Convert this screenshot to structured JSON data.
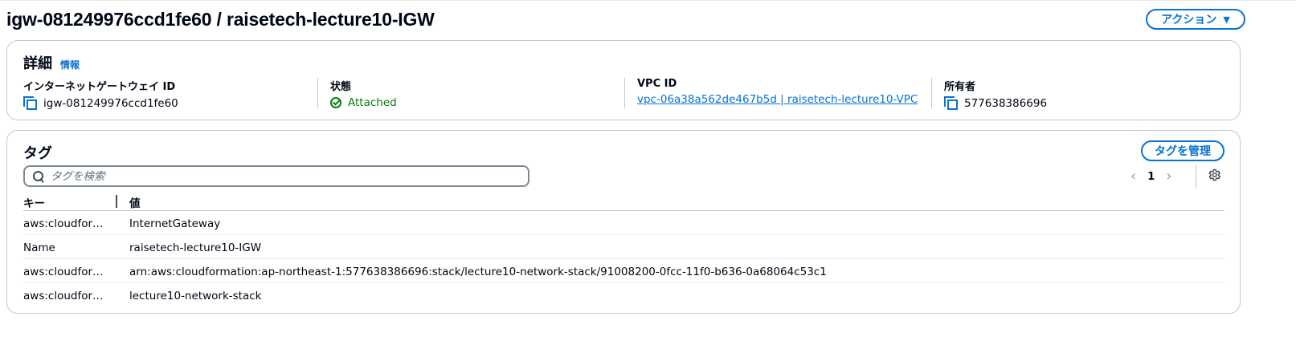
{
  "page": {
    "title": "igw-081249976ccd1fe60 / raisetech-lecture10-IGW",
    "actions_label": "アクション",
    "actions_caret": "▼"
  },
  "details": {
    "title": "詳細",
    "info_link": "情報",
    "fields": [
      {
        "label": "インターネットゲートウェイ ID",
        "value": "igw-081249976ccd1fe60",
        "icon": "copy-icon"
      },
      {
        "label": "状態",
        "value": "Attached",
        "icon": "status-success-icon",
        "color": "#037f0c"
      },
      {
        "label": "VPC ID",
        "value": "vpc-06a38a562de467b5d | raisetech-lecture10-VPC",
        "link": true
      },
      {
        "label": "所有者",
        "value": "577638386696",
        "icon": "copy-icon"
      }
    ]
  },
  "tags": {
    "title": "タグ",
    "manage_label": "タグを管理",
    "search_placeholder": "タグを検索",
    "pagination": {
      "prev": "‹",
      "page": "1",
      "next": "›"
    },
    "columns": [
      "キー",
      "値"
    ],
    "rows": [
      {
        "key": "aws:cloudfor…",
        "value": "InternetGateway"
      },
      {
        "key": "Name",
        "value": "raisetech-lecture10-IGW"
      },
      {
        "key": "aws:cloudfor…",
        "value": "arn:aws:cloudformation:ap-northeast-1:577638386696:stack/lecture10-network-stack/91008200-0fcc-11f0-b636-0a68064c53c1"
      },
      {
        "key": "aws:cloudfor…",
        "value": "lecture10-network-stack"
      }
    ]
  },
  "colors": {
    "accent": "#0972d3",
    "success": "#037f0c",
    "border": "#c6c6cd",
    "text": "#000716"
  }
}
